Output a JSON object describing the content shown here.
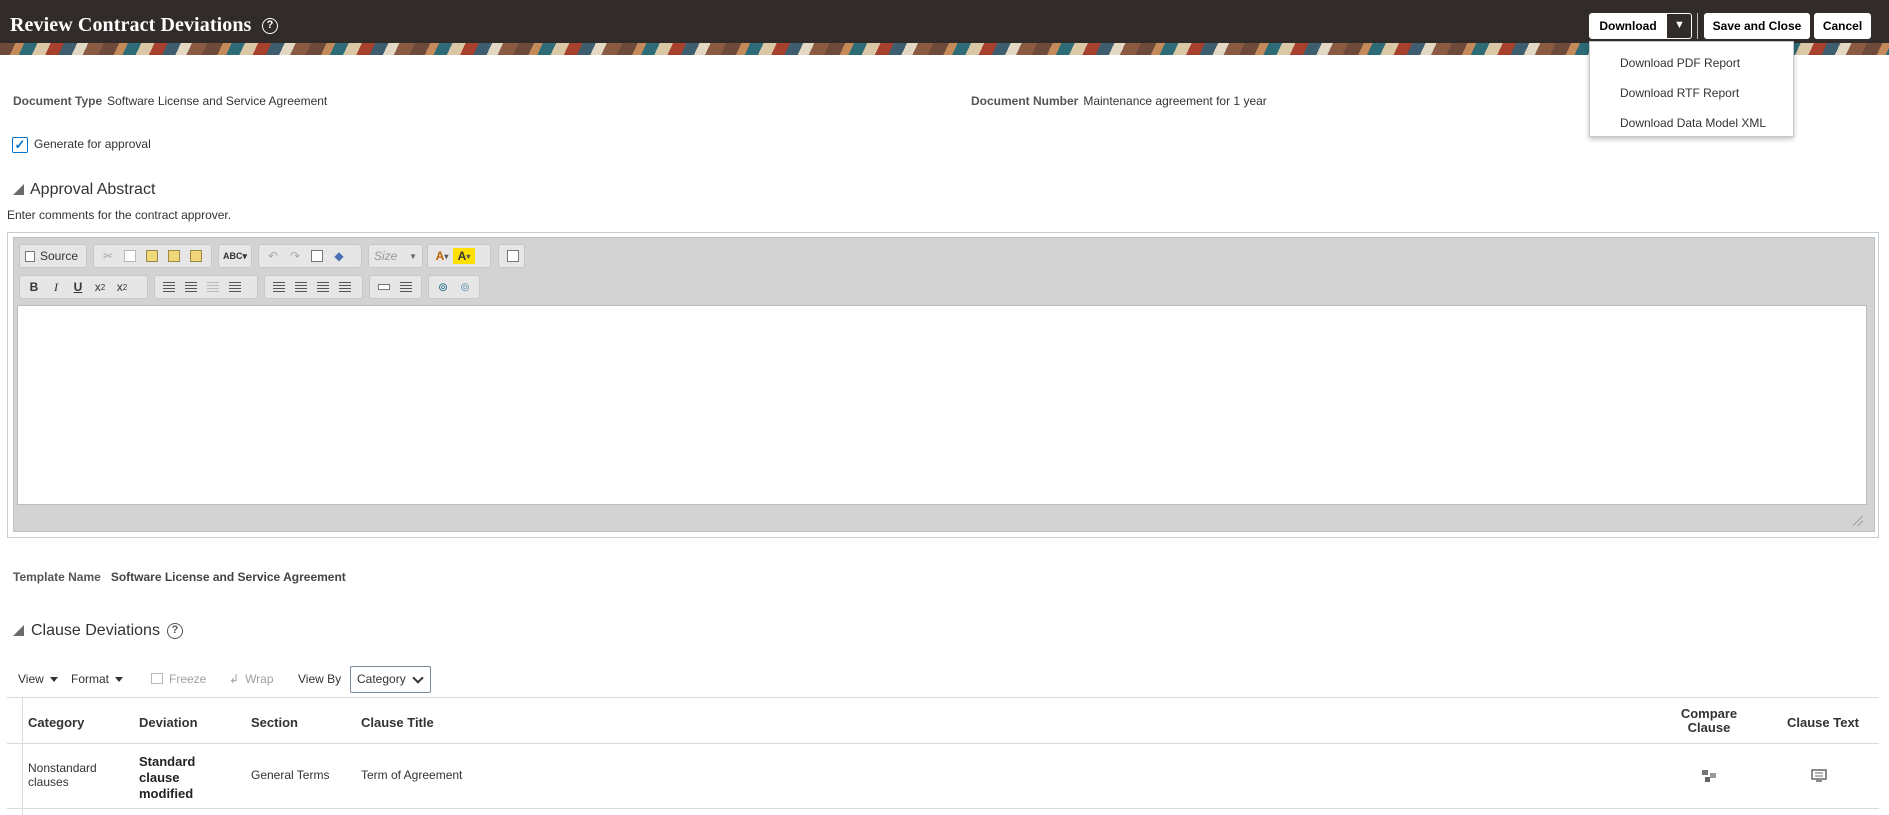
{
  "header": {
    "title": "Review Contract Deviations",
    "help_icon": "help-icon",
    "download_label": "Download",
    "save_close_label": "Save and Close",
    "cancel_label": "Cancel"
  },
  "download_menu": {
    "items": [
      "Download PDF Report",
      "Download RTF Report",
      "Download Data Model XML"
    ]
  },
  "document": {
    "type_label": "Document Type",
    "type_value": "Software License and Service Agreement",
    "number_label": "Document Number",
    "number_value": "Maintenance agreement for 1 year"
  },
  "approval": {
    "checkbox_label": "Generate for approval",
    "checked": true
  },
  "approval_abstract": {
    "title": "Approval Abstract",
    "instruction": "Enter comments for the contract approver."
  },
  "editor": {
    "source_label": "Source",
    "size_label": "Size",
    "content": ""
  },
  "template": {
    "label": "Template Name",
    "value": "Software License and Service Agreement"
  },
  "clause_deviations": {
    "title": "Clause Deviations",
    "toolbar": {
      "view_label": "View",
      "format_label": "Format",
      "freeze_label": "Freeze",
      "wrap_label": "Wrap",
      "view_by_label": "View By",
      "view_by_value": "Category"
    },
    "columns": [
      "Category",
      "Deviation",
      "Section",
      "Clause Title",
      "Compare Clause",
      "Clause Text"
    ],
    "rows": [
      {
        "category": "Nonstandard clauses",
        "deviation": "Standard clause modified",
        "section": "General Terms",
        "clause_title": "Term of Agreement"
      }
    ]
  },
  "colors": {
    "header_bg": "#312c29",
    "link_blue": "#0572ce",
    "toolbar_bg": "#e6e6e6"
  }
}
